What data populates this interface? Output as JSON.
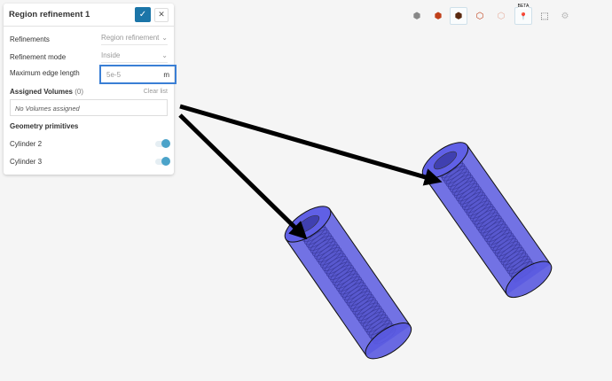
{
  "panel": {
    "title": "Region refinement 1",
    "confirm_icon": "check-icon",
    "close_icon": "close-icon",
    "refinements_label": "Refinements",
    "refinements_value": "Region refinement",
    "mode_label": "Refinement mode",
    "mode_value": "Inside",
    "edge_label": "Maximum edge length",
    "edge_value": "5e-5",
    "edge_unit": "m",
    "assigned_label": "Assigned Volumes",
    "assigned_count": "(0)",
    "clear_label": "Clear list",
    "no_volumes": "No Volumes assigned",
    "primitives_label": "Geometry primitives",
    "primitives": [
      {
        "name": "Cylinder 2",
        "on": true
      },
      {
        "name": "Cylinder 3",
        "on": true
      }
    ]
  },
  "toolbar": {
    "beta_label": "BETA"
  },
  "colors": {
    "accent": "#1b75a8",
    "highlight": "#3a7fd5",
    "cylinder": "#5a5ae0"
  }
}
